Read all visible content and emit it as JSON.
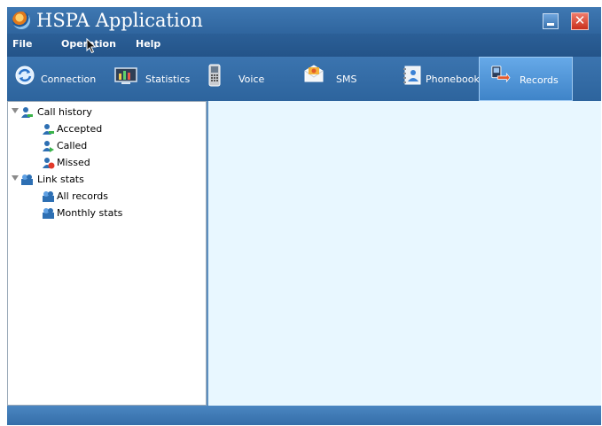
{
  "window": {
    "title": "HSPA Application"
  },
  "menu": {
    "items": [
      "File",
      "Operation",
      "Help"
    ]
  },
  "toolbar": {
    "items": [
      {
        "label": "Connection",
        "icon": "connection-icon"
      },
      {
        "label": "Statistics",
        "icon": "statistics-icon"
      },
      {
        "label": "Voice",
        "icon": "voice-icon"
      },
      {
        "label": "SMS",
        "icon": "sms-icon"
      },
      {
        "label": "Phonebook",
        "icon": "phonebook-icon"
      },
      {
        "label": "Records",
        "icon": "records-icon",
        "selected": true
      }
    ]
  },
  "tree": {
    "groups": [
      {
        "label": "Call history",
        "icon": "call-history-icon",
        "children": [
          {
            "label": "Accepted",
            "icon": "accepted-call-icon"
          },
          {
            "label": "Called",
            "icon": "called-icon"
          },
          {
            "label": "Missed",
            "icon": "missed-call-icon"
          }
        ]
      },
      {
        "label": "Link stats",
        "icon": "link-stats-icon",
        "children": [
          {
            "label": "All records",
            "icon": "all-records-icon"
          },
          {
            "label": "Monthly stats",
            "icon": "monthly-stats-icon"
          }
        ]
      }
    ]
  },
  "colors": {
    "accent": "#2f659e",
    "content_bg": "#e8f7ff"
  }
}
